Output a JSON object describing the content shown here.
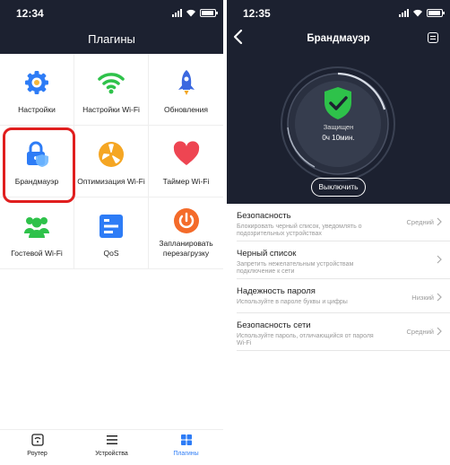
{
  "left": {
    "status_time": "12:34",
    "title": "Плагины",
    "plugins": [
      {
        "label": "Настройки",
        "icon": "gear-icon"
      },
      {
        "label": "Настройки Wi-Fi",
        "icon": "wifi-icon"
      },
      {
        "label": "Обновления",
        "icon": "rocket-icon"
      },
      {
        "label": "Брандмауэр",
        "icon": "lock-shield-icon",
        "highlighted": true
      },
      {
        "label": "Оптимизация Wi-Fi",
        "icon": "fan-icon"
      },
      {
        "label": "Таймер Wi-Fi",
        "icon": "heart-icon"
      },
      {
        "label": "Гостевой Wi-Fi",
        "icon": "guests-icon"
      },
      {
        "label": "QoS",
        "icon": "qos-icon"
      },
      {
        "label": "Запланировать перезагрузку",
        "icon": "power-icon"
      }
    ],
    "nav": [
      {
        "label": "Роутер",
        "icon": "router-icon"
      },
      {
        "label": "Устройства",
        "icon": "list-icon"
      },
      {
        "label": "Плагины",
        "icon": "grid-icon",
        "active": true
      }
    ]
  },
  "right": {
    "status_time": "12:35",
    "title": "Брандмауэр",
    "status_text": "Защищен",
    "timer": "0ч 10мин.",
    "off_button": "Выключить",
    "rows": [
      {
        "title": "Безопасность",
        "desc": "Блокировать черный список, уведомлять о подозрительных устройствах",
        "value": "Средний"
      },
      {
        "title": "Черный список",
        "desc": "Запретить нежелательным устройствам подключение к сети",
        "value": ""
      },
      {
        "title": "Надежность пароля",
        "desc": "Используйте в пароле буквы и цифры",
        "value": "Низкий"
      },
      {
        "title": "Безопасность сети",
        "desc": "Используйте пароль, отличающийся от пароля Wi-Fi",
        "value": "Средний"
      }
    ]
  },
  "colors": {
    "header_dark": "#1c2130",
    "accent_blue": "#2d7cf6",
    "highlight_red": "#e01e1e",
    "shield_green": "#2ec24a"
  }
}
